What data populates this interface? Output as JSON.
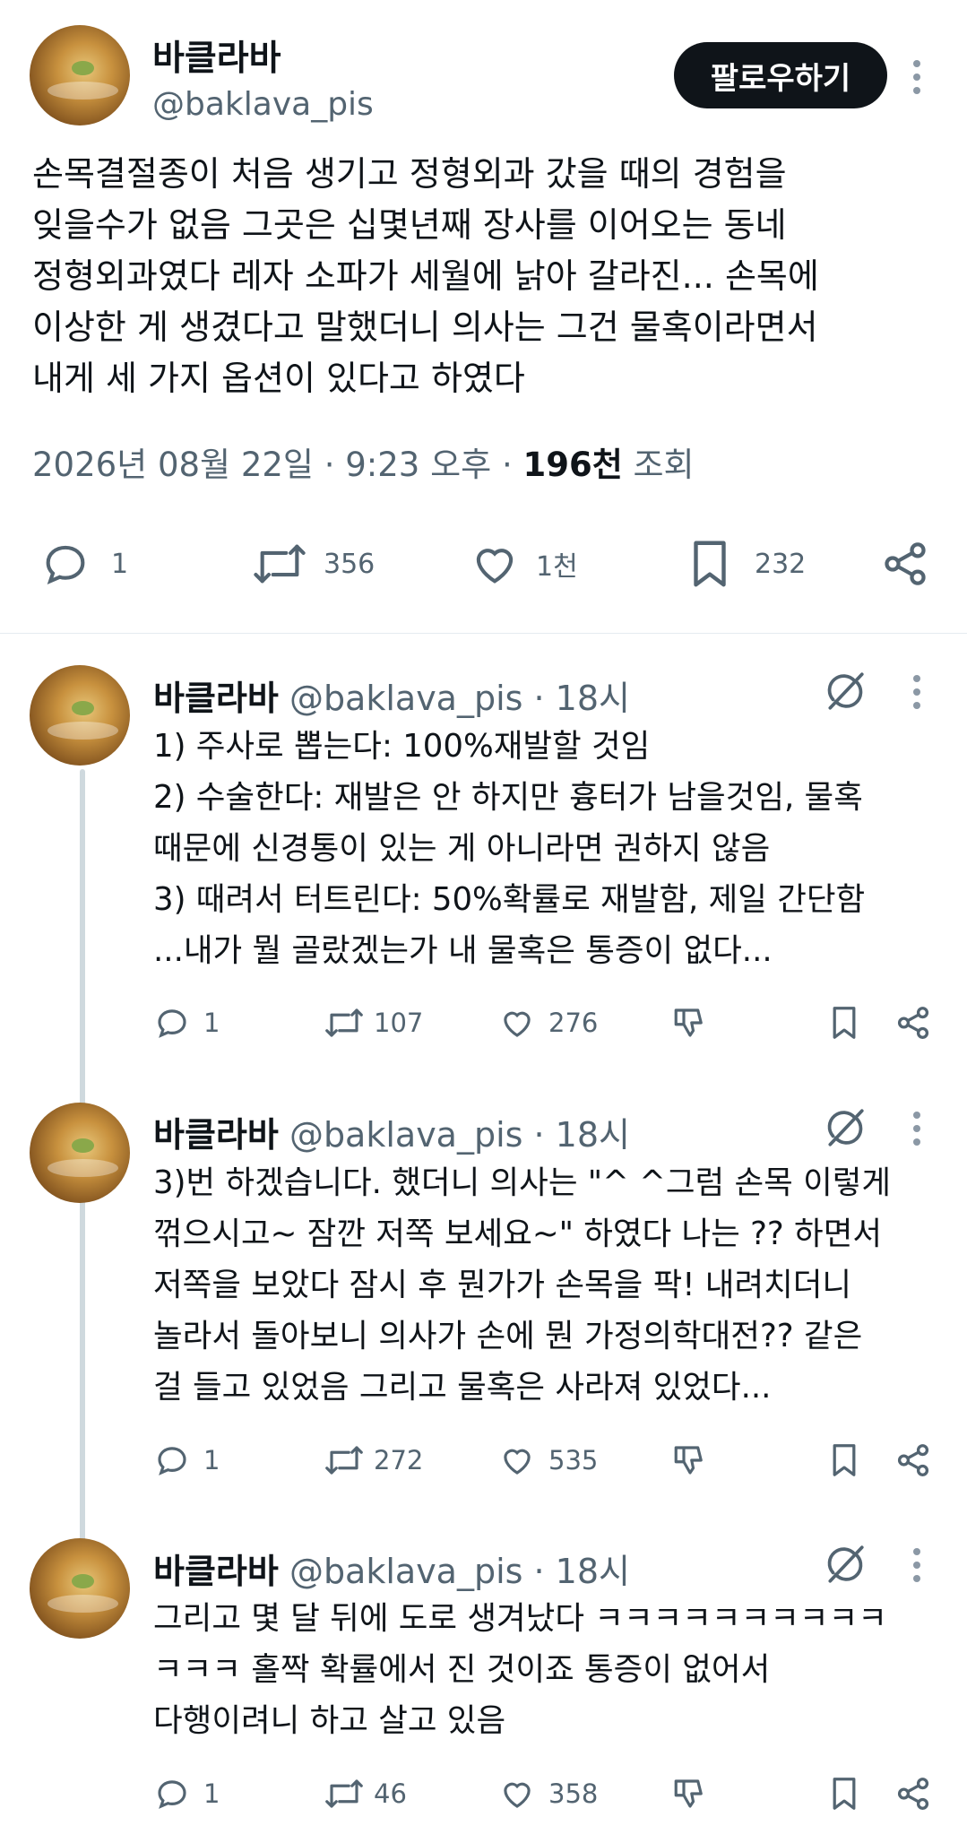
{
  "main_post": {
    "author_name": "바클라바",
    "handle": "@baklava_pis",
    "follow_label": "팔로우하기",
    "text_lines": [
      "손목결절종이 처음 생기고 정형외과 갔을 때의 경험을",
      "잊을수가 없음 그곳은 십몇년째 장사를 이어오는 동네",
      "정형외과였다 레자 소파가 세월에 낡아 갈라진... 손목에",
      "이상한 게 생겼다고 말했더니 의사는 그건 물혹이라면서",
      "내게 세 가지 옵션이 있다고 하였다"
    ],
    "timestamp": "2026년 08월 22일 · 9:23 오후 ·",
    "views_count": "196천",
    "views_label": "조회",
    "stats": {
      "replies": "1",
      "retweets": "356",
      "likes": "1천",
      "bookmarks": "232"
    }
  },
  "replies": [
    {
      "author_name": "바클라바",
      "meta": "@baklava_pis · 18시",
      "text_lines": [
        "1) 주사로 뽑는다: 100%재발할 것임",
        "2) 수술한다: 재발은 안 하지만 흉터가 남을것임, 물혹",
        "때문에 신경통이 있는 게 아니라면 권하지 않음",
        "3) 때려서 터트린다: 50%확률로 재발함, 제일 간단함",
        "...내가 뭘 골랐겠는가 내 물혹은 통증이 없다..."
      ],
      "stats": {
        "replies": "1",
        "retweets": "107",
        "likes": "276"
      }
    },
    {
      "author_name": "바클라바",
      "meta": "@baklava_pis · 18시",
      "text_lines": [
        "3)번 하겠습니다. 했더니 의사는 \"^ ^그럼 손목 이렇게",
        "꺾으시고~ 잠깐 저쪽 보세요~\" 하였다 나는 ?? 하면서",
        "저쪽을 보았다 잠시 후 뭔가가 손목을 팍! 내려치더니",
        "놀라서 돌아보니 의사가 손에 뭔 가정의학대전?? 같은",
        "걸 들고 있었음 그리고 물혹은 사라져 있었다..."
      ],
      "stats": {
        "replies": "1",
        "retweets": "272",
        "likes": "535"
      }
    },
    {
      "author_name": "바클라바",
      "meta": "@baklava_pis · 18시",
      "text_lines": [
        "그리고 몇 달 뒤에 도로 생겨났다 ㅋㅋㅋㅋㅋㅋㅋㅋㅋㅋ",
        "ㅋㅋㅋ 홀짝 확률에서 진 것이죠 통증이 없어서",
        "다행이려니 하고 살고 있음"
      ],
      "stats": {
        "replies": "1",
        "retweets": "46",
        "likes": "358"
      }
    }
  ]
}
